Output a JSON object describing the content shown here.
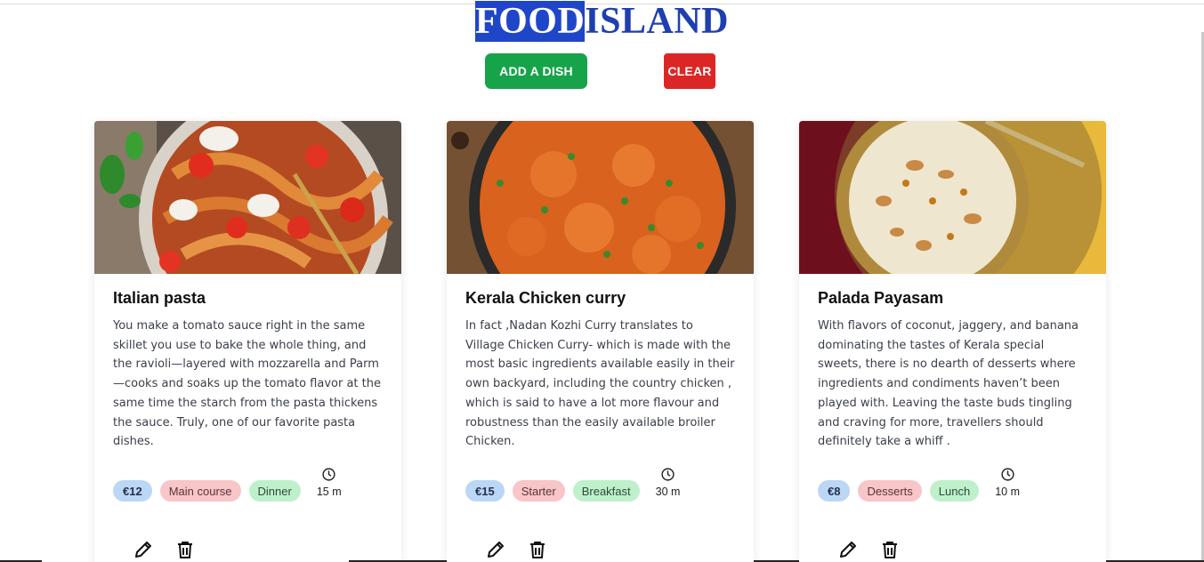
{
  "header": {
    "title_selected": "FOOD",
    "title_rest": "ISLAND"
  },
  "toolbar": {
    "add_label": "ADD A DISH",
    "clear_label": "CLEAR"
  },
  "colors": {
    "title": "#1f3fb0",
    "add_button": "#17a34a",
    "clear_button": "#dc2626",
    "price_tag": "#bcd6f5",
    "course_tag": "#f8c5c8",
    "meal_tag": "#bff0cc"
  },
  "cards": [
    {
      "title": "Italian pasta",
      "description": "You make a tomato sauce right in the same skillet you use to bake the whole thing, and the ravioli—layered with mozzarella and Parm—cooks and soaks up the tomato flavor at the same time the starch from the pasta thickens the sauce. Truly, one of our favorite pasta dishes.",
      "price": "€12",
      "course": "Main course",
      "meal": "Dinner",
      "time": "15 m",
      "icons": [
        "clock-icon",
        "pencil-icon",
        "trash-icon"
      ]
    },
    {
      "title": "Kerala Chicken curry",
      "description": "In fact ,Nadan Kozhi Curry translates to Village Chicken Curry- which is made with the most basic ingredients available easily in their own backyard, including the country chicken , which is said to have a lot more flavour and robustness than the easily available broiler Chicken.",
      "price": "€15",
      "course": "Starter",
      "meal": "Breakfast",
      "time": "30 m",
      "icons": [
        "clock-icon",
        "pencil-icon",
        "trash-icon"
      ]
    },
    {
      "title": "Palada Payasam",
      "description": "With flavors of coconut, jaggery, and banana dominating the tastes of Kerala special sweets, there is no dearth of desserts where ingredients and condiments haven’t been played with. Leaving the taste buds tingling and craving for more, travellers should definitely take a whiff .",
      "price": "€8",
      "course": "Desserts",
      "meal": "Lunch",
      "time": "10 m",
      "icons": [
        "clock-icon",
        "pencil-icon",
        "trash-icon"
      ]
    }
  ]
}
